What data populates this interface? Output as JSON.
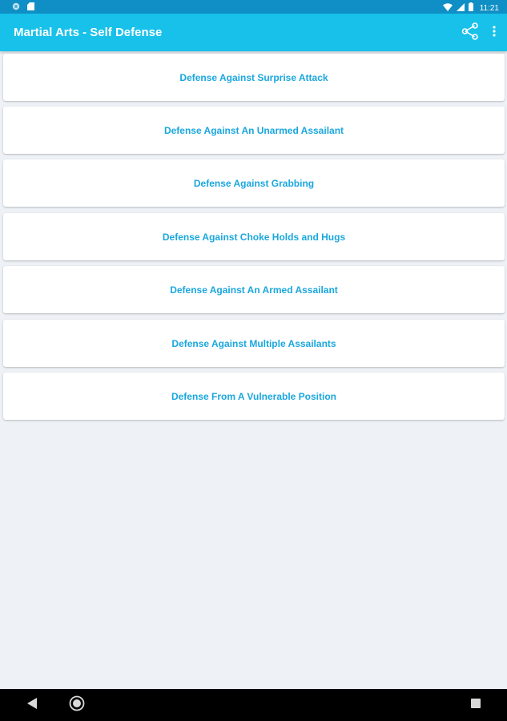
{
  "status_bar": {
    "time": "11:21",
    "left_icons": [
      "vpn-circle-icon",
      "sd-card-icon"
    ],
    "right_icons": [
      "wifi-icon",
      "cellular-signal-icon",
      "battery-icon"
    ]
  },
  "app_bar": {
    "title": "Martial Arts - Self Defense",
    "actions": [
      "share-icon",
      "overflow-menu-icon"
    ]
  },
  "menu": {
    "items": [
      {
        "label": "Defense Against Surprise Attack"
      },
      {
        "label": "Defense Against An Unarmed Assailant"
      },
      {
        "label": "Defense Against Grabbing"
      },
      {
        "label": "Defense Against Choke Holds and Hugs"
      },
      {
        "label": "Defense Against An Armed Assailant"
      },
      {
        "label": "Defense Against Multiple Assailants"
      },
      {
        "label": "Defense From A Vulnerable Position"
      }
    ]
  },
  "nav_bar": {
    "buttons": [
      "back-icon",
      "home-icon",
      "recents-icon"
    ]
  },
  "colors": {
    "status_bar": "#0f8fc5",
    "app_bar": "#17c1ea",
    "accent_text": "#1aa7de",
    "background": "#eef2f6",
    "nav_bar": "#000000"
  }
}
